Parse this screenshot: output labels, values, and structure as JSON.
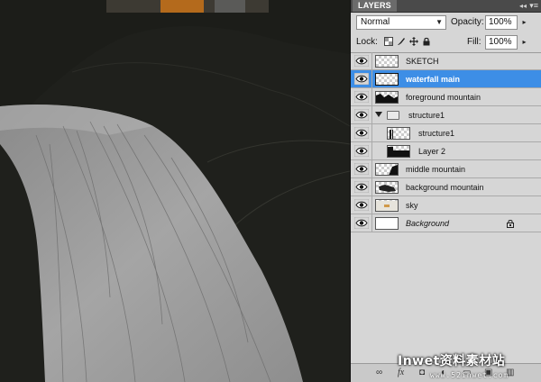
{
  "panel": {
    "tab_label": "LAYERS",
    "collapse_glyph": "◂◂",
    "menu_glyph": "▾≡",
    "blend_mode": "Normal",
    "opacity_label": "Opacity:",
    "opacity_value": "100%",
    "lock_label": "Lock:",
    "fill_label": "Fill:",
    "fill_value": "100%"
  },
  "layers": [
    {
      "name": "SKETCH",
      "visible": true,
      "selected": false,
      "thumb": "transparent"
    },
    {
      "name": "waterfall main",
      "visible": true,
      "selected": true,
      "thumb": "transparent"
    },
    {
      "name": "foreground mountain",
      "visible": true,
      "selected": false,
      "thumb": "mountain-dark"
    },
    {
      "name": "structure1",
      "visible": true,
      "selected": false,
      "thumb": "folder",
      "group": true,
      "expanded": true
    },
    {
      "name": "structure1",
      "visible": true,
      "selected": false,
      "thumb": "structure",
      "indent": true
    },
    {
      "name": "Layer 2",
      "visible": true,
      "selected": false,
      "thumb": "structure-dark",
      "indent": true
    },
    {
      "name": "middle mountain",
      "visible": true,
      "selected": false,
      "thumb": "mountain-mid"
    },
    {
      "name": "background mountain",
      "visible": true,
      "selected": false,
      "thumb": "mountain-bg"
    },
    {
      "name": "sky",
      "visible": true,
      "selected": false,
      "thumb": "sky"
    },
    {
      "name": "Background",
      "visible": true,
      "selected": false,
      "thumb": "white",
      "italic": true,
      "locked": true
    }
  ],
  "watermark": {
    "text": "Inwet资料素材站",
    "url": "www.52inwet.com"
  },
  "colors": {
    "selection": "#3d8ee6",
    "panel_bg": "#d6d6d6",
    "canvas_bg": "#1c1d19",
    "waterfall": "#9a9a9a"
  }
}
